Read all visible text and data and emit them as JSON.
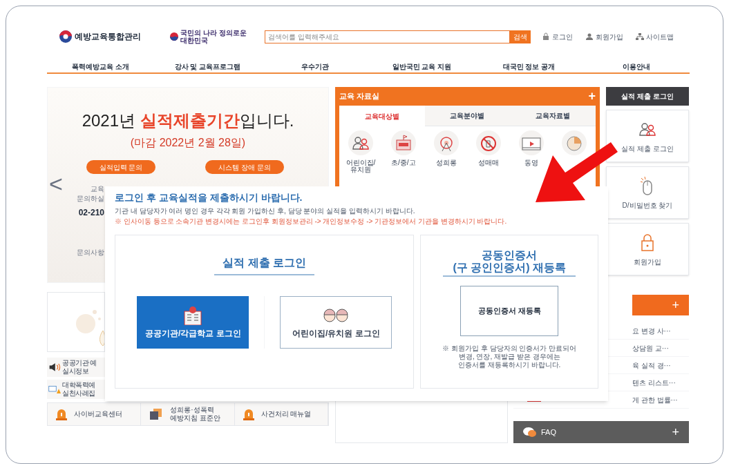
{
  "header": {
    "logo": "예방교육통합관리",
    "slogan": "국민의 나라 정의로운 대한민국",
    "search": {
      "placeholder": "검색어를 입력해주세요",
      "button": "검색"
    },
    "links": [
      {
        "kind": "lock",
        "label": "로그인"
      },
      {
        "kind": "person",
        "label": "회원가입"
      },
      {
        "kind": "sitemap",
        "label": "사이트맵"
      }
    ]
  },
  "nav": [
    "폭력예방교육 소개",
    "강사 및 교육프로그램",
    "우수기관",
    "일반국민 교육 지원",
    "대국민 정보 공개",
    "이용안내"
  ],
  "banner": {
    "title_year": "2021년 ",
    "title_highlight": "실적제출기간",
    "title_end": "입니다.",
    "deadline": "(마감 2022년 2월 28일)",
    "buttons": [
      "실적입력 문의",
      "시스템 장애 문의"
    ],
    "prev": "<",
    "snippets": [
      {
        "kind": "small",
        "text": "교육"
      },
      {
        "kind": "small",
        "text": "문의하실"
      },
      {
        "kind": "phone",
        "text": "02-210"
      },
      {
        "kind": "small",
        "text": "문의사항"
      }
    ]
  },
  "links_left": [
    {
      "kind": "speaker",
      "lines": [
        "공공기관 예",
        "실시정보"
      ]
    },
    {
      "kind": "book",
      "lines": [
        "대학폭력예",
        "실천사례집"
      ]
    }
  ],
  "bottom_links": [
    {
      "kind": "bell",
      "lines": [
        "사이버교육센터"
      ]
    },
    {
      "kind": "doc",
      "lines": [
        "성희롱·성폭력",
        "예방지침 표준안"
      ]
    },
    {
      "kind": "bell",
      "lines": [
        "사건처리 매뉴얼"
      ]
    }
  ],
  "materials": {
    "title": "교육 자료실",
    "more": "+",
    "tabs": [
      {
        "label": "교육대상별",
        "selected": true
      },
      {
        "label": "교육분야별",
        "selected": false
      },
      {
        "label": "교육자료별",
        "selected": false
      }
    ],
    "tiles": [
      {
        "kind": "people",
        "label": "어린이집/\n유치원"
      },
      {
        "kind": "school",
        "label": "초/중/고"
      },
      {
        "kind": "ring",
        "label": "성희롱"
      },
      {
        "kind": "ban",
        "label": "성매매"
      },
      {
        "kind": "video",
        "label": "동영"
      },
      {
        "kind": "pie"
      }
    ]
  },
  "side": {
    "title": "실적 제출 로그인",
    "cards": [
      {
        "kind": "people",
        "label": "실적 제출 로그인"
      },
      {
        "kind": "mouse",
        "label": "D/비밀번호 찾기"
      },
      {
        "kind": "lock",
        "label": "회원가입"
      }
    ]
  },
  "notice": {
    "more": "+",
    "items": [
      "요 변경 사···",
      "상담원 교···",
      "육 실적 경···",
      "텐츠 리스트···",
      "게 관한 법률···"
    ]
  },
  "faq": {
    "label": "FAQ",
    "more": "+"
  },
  "popup": {
    "heading": "로그인 후 교육실적을 제출하시기 바랍니다.",
    "info": "기관 내 담당자가 여러 명인 경우 각각 회원 가입하신 후, 담당 분야의 실적을 입력하시기 바랍니다.",
    "warning": "※ 인사이동 등으로 소속기관 변경시에는 로그인후 회원정보관리 -> 개인정보수정 -> 기관정보에서 기관을 변경하시기 바랍니다.",
    "login": {
      "title": "실적 제출 로그인",
      "buttons": [
        {
          "kind": "public",
          "label": "공공기관/각급학교 로그인"
        },
        {
          "kind": "kids",
          "label": "어린이집/유치원 로그인"
        }
      ]
    },
    "cert": {
      "title": [
        "공동인증서",
        "(구 공인인증서) 재등록"
      ],
      "button": "공동인증서 재등록",
      "note": [
        "※ 회원가입 후 담당자의 인증서가 만료되어",
        "변경, 연장, 재발급 받은 경우에는",
        "인증서를 재등록하시기 바랍니다."
      ]
    }
  }
}
